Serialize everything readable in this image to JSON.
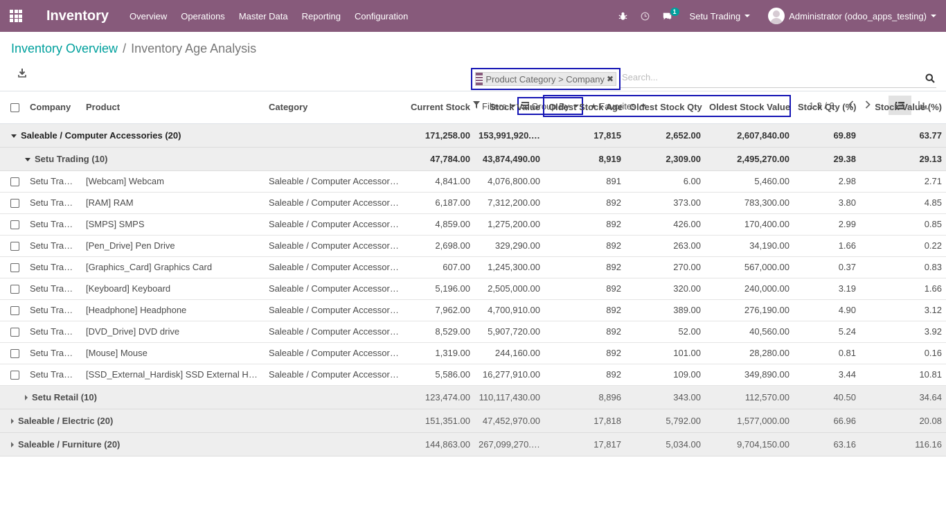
{
  "navbar": {
    "app_title": "Inventory",
    "menu": [
      "Overview",
      "Operations",
      "Master Data",
      "Reporting",
      "Configuration"
    ],
    "messages_badge": "1",
    "company": "Setu Trading",
    "user": "Administrator (odoo_apps_testing)"
  },
  "breadcrumb": {
    "parent": "Inventory Overview",
    "separator": "/",
    "current": "Inventory Age Analysis"
  },
  "search": {
    "facet_label": "Product Category > Company",
    "placeholder": "Search..."
  },
  "search_options": {
    "filters": "Filters",
    "group_by": "Group By",
    "favorites": "Favorites"
  },
  "pager": {
    "value": "1-3 / 3"
  },
  "table": {
    "columns": {
      "company": "Company",
      "product": "Product",
      "category": "Category",
      "current_stock": "Current Stock",
      "stock_value": "Stock Value",
      "oldest_age": "Oldest Stock Age",
      "oldest_qty": "Oldest Stock Qty",
      "oldest_value": "Oldest Stock Value",
      "qty_pct": "Stock Qty (%)",
      "value_pct": "Stock Value (%)"
    },
    "group1": {
      "label": "Saleable / Computer Accessories (20)",
      "current_stock": "171,258.00",
      "stock_value": "153,991,920.00",
      "oldest_age": "17,815",
      "oldest_qty": "2,652.00",
      "oldest_value": "2,607,840.00",
      "qty_pct": "69.89",
      "value_pct": "63.77"
    },
    "subgroup1": {
      "label": "Setu Trading (10)",
      "current_stock": "47,784.00",
      "stock_value": "43,874,490.00",
      "oldest_age": "8,919",
      "oldest_qty": "2,309.00",
      "oldest_value": "2,495,270.00",
      "qty_pct": "29.38",
      "value_pct": "29.13"
    },
    "rows": [
      {
        "company": "Setu Trading",
        "product": "[Webcam] Webcam",
        "category": "Saleable / Computer Accessories",
        "current_stock": "4,841.00",
        "stock_value": "4,076,800.00",
        "oldest_age": "891",
        "oldest_qty": "6.00",
        "oldest_value": "5,460.00",
        "qty_pct": "2.98",
        "value_pct": "2.71"
      },
      {
        "company": "Setu Trading",
        "product": "[RAM] RAM",
        "category": "Saleable / Computer Accessories",
        "current_stock": "6,187.00",
        "stock_value": "7,312,200.00",
        "oldest_age": "892",
        "oldest_qty": "373.00",
        "oldest_value": "783,300.00",
        "qty_pct": "3.80",
        "value_pct": "4.85"
      },
      {
        "company": "Setu Trading",
        "product": "[SMPS] SMPS",
        "category": "Saleable / Computer Accessories",
        "current_stock": "4,859.00",
        "stock_value": "1,275,200.00",
        "oldest_age": "892",
        "oldest_qty": "426.00",
        "oldest_value": "170,400.00",
        "qty_pct": "2.99",
        "value_pct": "0.85"
      },
      {
        "company": "Setu Trading",
        "product": "[Pen_Drive] Pen Drive",
        "category": "Saleable / Computer Accessories",
        "current_stock": "2,698.00",
        "stock_value": "329,290.00",
        "oldest_age": "892",
        "oldest_qty": "263.00",
        "oldest_value": "34,190.00",
        "qty_pct": "1.66",
        "value_pct": "0.22"
      },
      {
        "company": "Setu Trading",
        "product": "[Graphics_Card] Graphics Card",
        "category": "Saleable / Computer Accessories",
        "current_stock": "607.00",
        "stock_value": "1,245,300.00",
        "oldest_age": "892",
        "oldest_qty": "270.00",
        "oldest_value": "567,000.00",
        "qty_pct": "0.37",
        "value_pct": "0.83"
      },
      {
        "company": "Setu Trading",
        "product": "[Keyboard] Keyboard",
        "category": "Saleable / Computer Accessories",
        "current_stock": "5,196.00",
        "stock_value": "2,505,000.00",
        "oldest_age": "892",
        "oldest_qty": "320.00",
        "oldest_value": "240,000.00",
        "qty_pct": "3.19",
        "value_pct": "1.66"
      },
      {
        "company": "Setu Trading",
        "product": "[Headphone] Headphone",
        "category": "Saleable / Computer Accessories",
        "current_stock": "7,962.00",
        "stock_value": "4,700,910.00",
        "oldest_age": "892",
        "oldest_qty": "389.00",
        "oldest_value": "276,190.00",
        "qty_pct": "4.90",
        "value_pct": "3.12"
      },
      {
        "company": "Setu Trading",
        "product": "[DVD_Drive] DVD drive",
        "category": "Saleable / Computer Accessories",
        "current_stock": "8,529.00",
        "stock_value": "5,907,720.00",
        "oldest_age": "892",
        "oldest_qty": "52.00",
        "oldest_value": "40,560.00",
        "qty_pct": "5.24",
        "value_pct": "3.92"
      },
      {
        "company": "Setu Trading",
        "product": "[Mouse] Mouse",
        "category": "Saleable / Computer Accessories",
        "current_stock": "1,319.00",
        "stock_value": "244,160.00",
        "oldest_age": "892",
        "oldest_qty": "101.00",
        "oldest_value": "28,280.00",
        "qty_pct": "0.81",
        "value_pct": "0.16"
      },
      {
        "company": "Setu Trading",
        "product": "[SSD_External_Hardisk] SSD External Hardi...",
        "category": "Saleable / Computer Accessories",
        "current_stock": "5,586.00",
        "stock_value": "16,277,910.00",
        "oldest_age": "892",
        "oldest_qty": "109.00",
        "oldest_value": "349,890.00",
        "qty_pct": "3.44",
        "value_pct": "10.81"
      }
    ],
    "subgroup2": {
      "label": "Setu Retail (10)",
      "current_stock": "123,474.00",
      "stock_value": "110,117,430.00",
      "oldest_age": "8,896",
      "oldest_qty": "343.00",
      "oldest_value": "112,570.00",
      "qty_pct": "40.50",
      "value_pct": "34.64"
    },
    "group2": {
      "label": "Saleable / Electric (20)",
      "current_stock": "151,351.00",
      "stock_value": "47,452,970.00",
      "oldest_age": "17,818",
      "oldest_qty": "5,792.00",
      "oldest_value": "1,577,000.00",
      "qty_pct": "66.96",
      "value_pct": "20.08"
    },
    "group3": {
      "label": "Saleable / Furniture (20)",
      "current_stock": "144,863.00",
      "stock_value": "267,099,270.00",
      "oldest_age": "17,817",
      "oldest_qty": "5,034.00",
      "oldest_value": "9,704,150.00",
      "qty_pct": "63.16",
      "value_pct": "116.16"
    }
  },
  "colors": {
    "brand": "#875a7b",
    "link": "#00a09d",
    "highlight": "#1414b4"
  },
  "icons": [
    "apps-grid-icon",
    "bug-icon",
    "clock-icon",
    "chat-icon",
    "download-icon",
    "search-icon",
    "filter-icon",
    "list-icon",
    "star-icon",
    "chevron-left-icon",
    "chevron-right-icon",
    "list-view-icon",
    "graph-view-icon"
  ]
}
